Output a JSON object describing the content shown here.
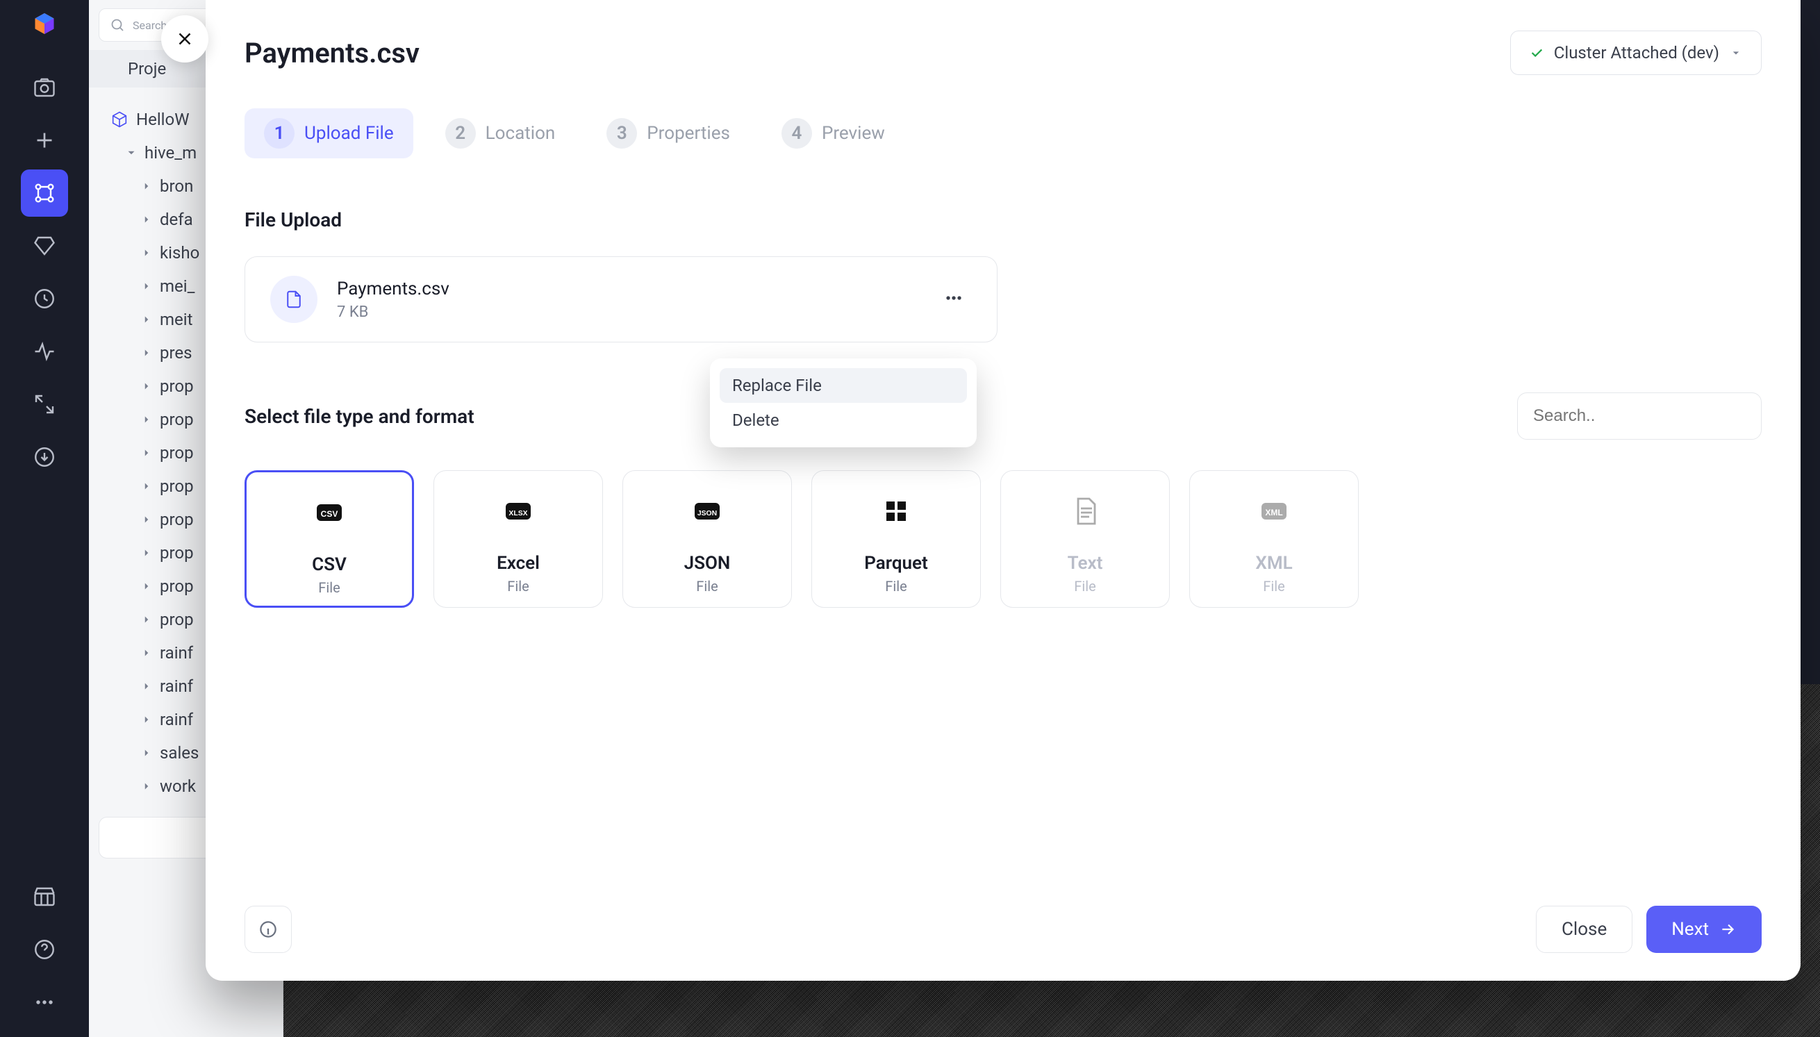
{
  "search_placeholder": "Search",
  "project_label": "Proje",
  "tree": {
    "root": "HelloW",
    "expanded": "hive_m",
    "items": [
      "bron",
      "defa",
      "kisho",
      "mei_",
      "meit",
      "pres",
      "prop",
      "prop",
      "prop",
      "prop",
      "prop",
      "prop",
      "prop",
      "prop",
      "rainf",
      "rainf",
      "rainf",
      "sales",
      "work"
    ]
  },
  "modal": {
    "title": "Payments.csv",
    "cluster": "Cluster Attached (dev)",
    "steps": [
      {
        "num": "1",
        "label": "Upload File"
      },
      {
        "num": "2",
        "label": "Location"
      },
      {
        "num": "3",
        "label": "Properties"
      },
      {
        "num": "4",
        "label": "Preview"
      }
    ],
    "file_upload_heading": "File Upload",
    "file": {
      "name": "Payments.csv",
      "size": "7 KB"
    },
    "ctx": {
      "replace": "Replace File",
      "delete": "Delete"
    },
    "format_heading": "Select file type and format",
    "format_search_placeholder": "Search..",
    "formats": [
      {
        "name": "CSV",
        "sub": "File",
        "selected": true
      },
      {
        "name": "Excel",
        "sub": "File"
      },
      {
        "name": "JSON",
        "sub": "File"
      },
      {
        "name": "Parquet",
        "sub": "File"
      },
      {
        "name": "Text",
        "sub": "File",
        "disabled": true
      },
      {
        "name": "XML",
        "sub": "File",
        "disabled": true
      }
    ],
    "footer": {
      "close": "Close",
      "next": "Next"
    }
  }
}
